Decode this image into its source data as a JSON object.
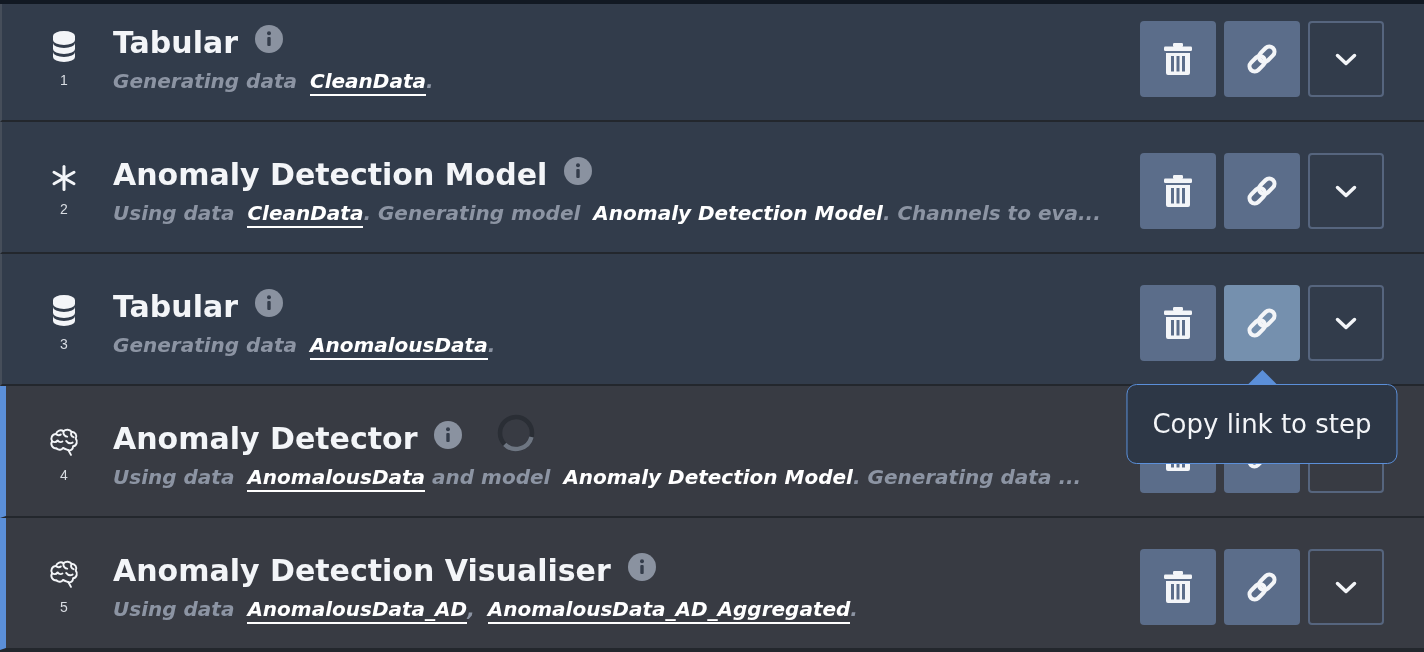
{
  "steps": [
    {
      "kind": "dataset",
      "number": "1",
      "title": "Tabular",
      "stale": false,
      "running": false,
      "link_hovered": false,
      "description": [
        {
          "kind": "text",
          "text": "Generating data"
        },
        {
          "kind": "link",
          "text": "CleanData"
        },
        {
          "kind": "text",
          "text": "."
        }
      ]
    },
    {
      "kind": "model",
      "number": "2",
      "title": "Anomaly Detection Model",
      "stale": false,
      "running": false,
      "link_hovered": false,
      "description": [
        {
          "kind": "text",
          "text": "Using data"
        },
        {
          "kind": "link",
          "text": "CleanData"
        },
        {
          "kind": "text",
          "text": ". Generating model"
        },
        {
          "kind": "bold",
          "text": "Anomaly Detection Model"
        },
        {
          "kind": "text",
          "text": ". Channels to eva..."
        }
      ]
    },
    {
      "kind": "dataset",
      "number": "3",
      "title": "Tabular",
      "stale": false,
      "running": false,
      "link_hovered": true,
      "link_tooltip": "Copy link to step",
      "description": [
        {
          "kind": "text",
          "text": "Generating data"
        },
        {
          "kind": "link",
          "text": "AnomalousData"
        },
        {
          "kind": "text",
          "text": "."
        }
      ]
    },
    {
      "kind": "analysis",
      "number": "4",
      "title": "Anomaly Detector",
      "stale": true,
      "running": true,
      "link_hovered": false,
      "description": [
        {
          "kind": "text",
          "text": "Using data"
        },
        {
          "kind": "link",
          "text": "AnomalousData"
        },
        {
          "kind": "text",
          "text": " and model"
        },
        {
          "kind": "bold",
          "text": "Anomaly Detection Model"
        },
        {
          "kind": "text",
          "text": ". Generating data ..."
        }
      ]
    },
    {
      "kind": "analysis",
      "number": "5",
      "title": "Anomaly Detection Visualiser",
      "stale": true,
      "running": false,
      "link_hovered": false,
      "description": [
        {
          "kind": "text",
          "text": "Using data"
        },
        {
          "kind": "link",
          "text": "AnomalousData_AD"
        },
        {
          "kind": "text",
          "text": ","
        },
        {
          "kind": "link",
          "text": "AnomalousData_AD_Aggregated"
        },
        {
          "kind": "text",
          "text": "."
        }
      ]
    }
  ]
}
